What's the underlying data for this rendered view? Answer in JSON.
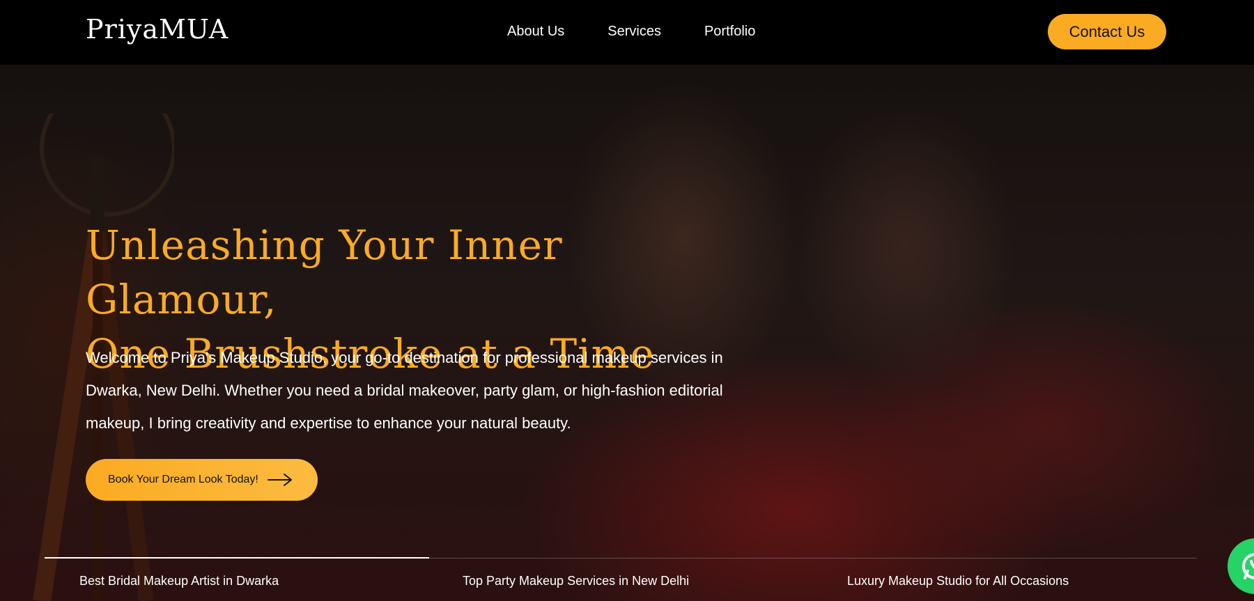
{
  "header": {
    "logo": "PriyaMUA",
    "nav": [
      {
        "label": "About Us"
      },
      {
        "label": "Services"
      },
      {
        "label": "Portfolio"
      }
    ],
    "contact_label": "Contact Us"
  },
  "hero": {
    "headline_line1": "Unleashing Your Inner Glamour,",
    "headline_line2": "One Brushstroke at a Time",
    "intro": "Welcome to Priya's Makeup Studio, your go-to destination for professional makeup services in Dwarka, New Delhi. Whether you need a bridal makeover, party glam, or high-fashion editorial makeup, I bring creativity and expertise to enhance your natural beauty.",
    "cta_label": "Book Your Dream Look Today!"
  },
  "taglines": [
    {
      "label": "Best Bridal Makeup Artist in Dwarka"
    },
    {
      "label": "Top Party Makeup Services in New Delhi"
    },
    {
      "label": "Luxury Makeup Studio for All Occasions"
    }
  ],
  "colors": {
    "accent": "#fbab22",
    "header_bg": "#000000",
    "whatsapp": "#25d366"
  },
  "icons": {
    "cta_arrow": "arrow-right-icon",
    "whatsapp": "whatsapp-icon"
  }
}
